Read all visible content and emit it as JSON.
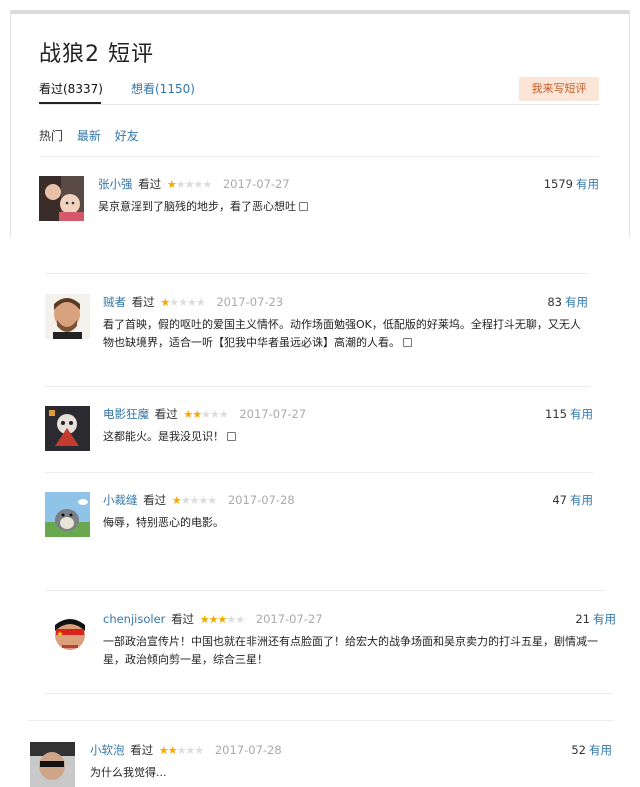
{
  "page": {
    "title": "战狼2 短评",
    "tabs": [
      {
        "label": "看过(8337)"
      },
      {
        "label": "想看(1150)"
      }
    ],
    "write_button": "我来写短评",
    "sort": [
      {
        "label": "热门"
      },
      {
        "label": "最新"
      },
      {
        "label": "好友"
      }
    ]
  },
  "comments": [
    {
      "user": "张小强",
      "watched": "看过",
      "stars": 1,
      "date": "2017-07-27",
      "votes": "1579",
      "votes_label": "有用",
      "text": "吴京意淫到了脑残的地步，看了恶心想吐"
    },
    {
      "user": "贼者",
      "watched": "看过",
      "stars": 1,
      "date": "2017-07-23",
      "votes": "83",
      "votes_label": "有用",
      "text": "看了首映，假的呕吐的爱国主义情怀。动作场面勉强OK，低配版的好莱坞。全程打斗无聊，又无人物也缺境界，适合一听【犯我中华者虽远必诛】高潮的人看。"
    },
    {
      "user": "电影狂魔",
      "watched": "看过",
      "stars": 2,
      "date": "2017-07-27",
      "votes": "115",
      "votes_label": "有用",
      "text": "这都能火。是我没见识！"
    },
    {
      "user": "小裁缝",
      "watched": "看过",
      "stars": 1,
      "date": "2017-07-28",
      "votes": "47",
      "votes_label": "有用",
      "text": "侮辱，特别恶心的电影。"
    },
    {
      "user": "chenjisoler",
      "watched": "看过",
      "stars": 3,
      "date": "2017-07-27",
      "votes": "21",
      "votes_label": "有用",
      "text": "一部政治宣传片！中国也就在非洲还有点脸面了！给宏大的战争场面和吴京卖力的打斗五星，剧情减一星，政治倾向剪一星，综合三星！"
    },
    {
      "user": "小软泡",
      "watched": "看过",
      "stars": 2,
      "date": "2017-07-28",
      "votes": "52",
      "votes_label": "有用",
      "text": "为什么我觉得..."
    }
  ],
  "icons": {
    "star": "star-icon",
    "message": "message-icon"
  },
  "colors": {
    "link": "#3377aa",
    "star": "#f7a700",
    "write_button_bg": "#fbe5d6"
  }
}
